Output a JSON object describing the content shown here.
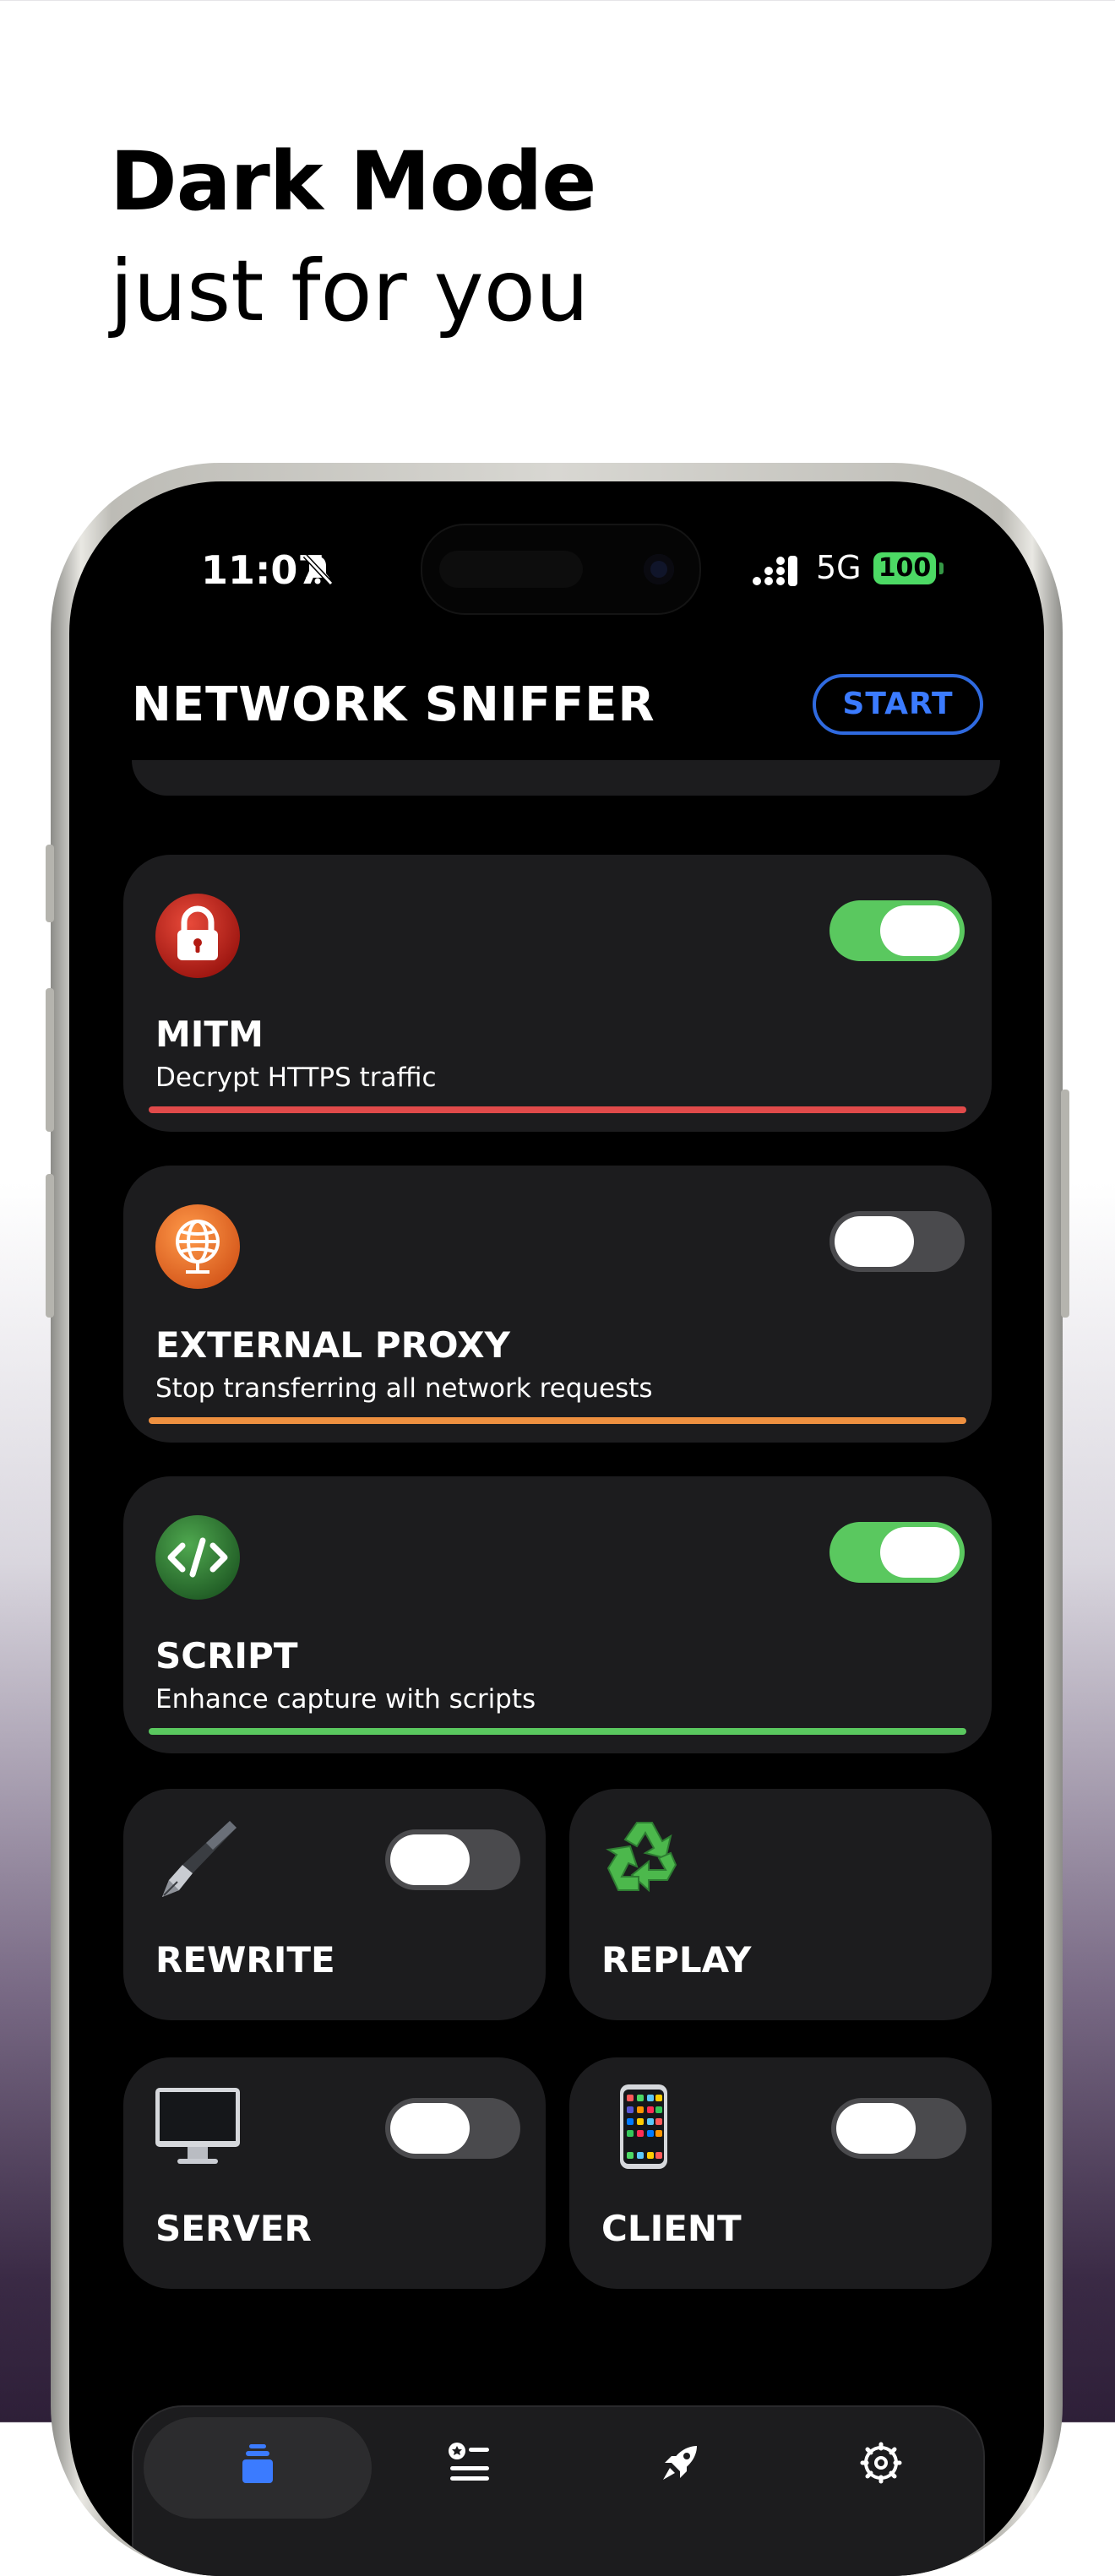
{
  "headline": {
    "line1": "Dark Mode",
    "line2": "just for you"
  },
  "status_bar": {
    "time": "11:07",
    "network": "5G",
    "battery": "100"
  },
  "header": {
    "title": "NETWORK SNIFFER",
    "start_label": "START"
  },
  "colors": {
    "accent": "#3b7bff",
    "toggle_on": "#5ac85f",
    "mitm_bar": "#e04a4a",
    "proxy_bar": "#ee9040",
    "script_bar": "#5ac85f"
  },
  "cards": [
    {
      "id": "mitm",
      "icon": "lock-icon",
      "title": "MITM",
      "desc": "Decrypt HTTPS traffic",
      "enabled": true
    },
    {
      "id": "external-proxy",
      "icon": "globe-icon",
      "title": "EXTERNAL PROXY",
      "desc": "Stop transferring all network requests",
      "enabled": false
    },
    {
      "id": "script",
      "icon": "code-icon",
      "title": "SCRIPT",
      "desc": "Enhance capture with scripts",
      "enabled": true
    }
  ],
  "tiles": [
    {
      "id": "rewrite",
      "icon": "fountain-pen-icon",
      "title": "REWRITE",
      "enabled": false
    },
    {
      "id": "replay",
      "icon": "recycle-icon",
      "title": "REPLAY"
    },
    {
      "id": "server",
      "icon": "desktop-computer-icon",
      "title": "SERVER",
      "enabled": false
    },
    {
      "id": "client",
      "icon": "mobile-phone-icon",
      "title": "CLIENT",
      "enabled": false
    }
  ],
  "tabbar": {
    "icons": [
      "stack-icon",
      "list-icon",
      "rocket-icon",
      "settings-gear-icon"
    ],
    "active_index": 0
  }
}
